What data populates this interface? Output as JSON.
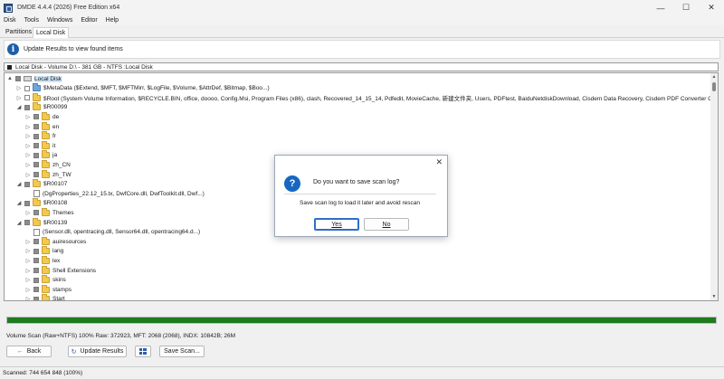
{
  "window": {
    "title": "DMDE 4.4.4 (2026) Free Edition x64",
    "minimize_glyph": "—",
    "maximize_glyph": "☐",
    "close_glyph": "✕"
  },
  "menu": [
    "Disk",
    "Tools",
    "Windows",
    "Editor",
    "Help"
  ],
  "tabs": [
    {
      "label": "Partitions",
      "active": false
    },
    {
      "label": "Local Disk",
      "active": true
    }
  ],
  "info_bar": {
    "icon": "info-icon",
    "icon_glyph": "i",
    "text": "Update Results to view found items"
  },
  "path_bar": {
    "text": "Local Disk - Volume D:\\ - 381 GB - NTFS :Local Disk"
  },
  "tree": [
    {
      "label": "Local Disk",
      "level": 0,
      "toggle": "▲",
      "icon": "drive",
      "checkbox": "partial",
      "selected": true
    },
    {
      "label": "$MetaData ($Extend, $MFT, $MFTMirr, $LogFile, $Volume, $AttrDef, $Bitmap, $Boo...)",
      "level": 1,
      "toggle": "▷",
      "icon": "folder-blue",
      "checkbox": "empty"
    },
    {
      "label": "$Root (System Volume Information, $RECYCLE.BIN, office, doooo, Config.Msi, Program Files (x86), clash, Recovered_14_15_14, Pdfedit, MovieCache, 新建文件夹, Users, PDFtest, BaiduNetdiskDownload, Cisdem Data Recovery, Cisdem PDF Converter O",
      "level": 1,
      "toggle": "▷",
      "icon": "folder",
      "checkbox": "empty"
    },
    {
      "label": "$R00099",
      "level": 1,
      "toggle": "◢",
      "icon": "folder",
      "checkbox": "partial"
    },
    {
      "label": "de",
      "level": 2,
      "toggle": "▷",
      "icon": "folder",
      "checkbox": "partial"
    },
    {
      "label": "en",
      "level": 2,
      "toggle": "▷",
      "icon": "folder",
      "checkbox": "partial"
    },
    {
      "label": "fr",
      "level": 2,
      "toggle": "▷",
      "icon": "folder",
      "checkbox": "partial"
    },
    {
      "label": "it",
      "level": 2,
      "toggle": "▷",
      "icon": "folder",
      "checkbox": "partial"
    },
    {
      "label": "ja",
      "level": 2,
      "toggle": "▷",
      "icon": "folder",
      "checkbox": "partial"
    },
    {
      "label": "zh_CN",
      "level": 2,
      "toggle": "▷",
      "icon": "folder",
      "checkbox": "partial"
    },
    {
      "label": "zh_TW",
      "level": 2,
      "toggle": "▷",
      "icon": "folder",
      "checkbox": "partial"
    },
    {
      "label": "$R00107",
      "level": 1,
      "toggle": "◢",
      "icon": "folder",
      "checkbox": "partial"
    },
    {
      "label": "(DgProperties_22.12_15.tx, DwfCore.dll, DwfToolkit.dll, Dwf...)",
      "level": 2,
      "toggle": "",
      "icon": "file",
      "checkbox": "none"
    },
    {
      "label": "$R00108",
      "level": 1,
      "toggle": "◢",
      "icon": "folder",
      "checkbox": "partial"
    },
    {
      "label": "Themes",
      "level": 2,
      "toggle": "▷",
      "icon": "folder",
      "checkbox": "partial"
    },
    {
      "label": "$R00139",
      "level": 1,
      "toggle": "◢",
      "icon": "folder",
      "checkbox": "partial"
    },
    {
      "label": "(Sensor.dll, opentracing.dll, Sensor64.dll, opentracing64.d...)",
      "level": 2,
      "toggle": "",
      "icon": "file",
      "checkbox": "none"
    },
    {
      "label": "auiresources",
      "level": 2,
      "toggle": "▷",
      "icon": "folder",
      "checkbox": "partial"
    },
    {
      "label": "lang",
      "level": 2,
      "toggle": "▷",
      "icon": "folder",
      "checkbox": "partial"
    },
    {
      "label": "lex",
      "level": 2,
      "toggle": "▷",
      "icon": "folder",
      "checkbox": "partial"
    },
    {
      "label": "Shell Extensions",
      "level": 2,
      "toggle": "▷",
      "icon": "folder",
      "checkbox": "partial"
    },
    {
      "label": "skins",
      "level": 2,
      "toggle": "▷",
      "icon": "folder",
      "checkbox": "partial"
    },
    {
      "label": "stamps",
      "level": 2,
      "toggle": "▷",
      "icon": "folder",
      "checkbox": "partial"
    },
    {
      "label": "Start",
      "level": 2,
      "toggle": "▷",
      "icon": "folder",
      "checkbox": "partial"
    }
  ],
  "progress": {
    "fraction": 1.0,
    "color": "#1e7b1e"
  },
  "scan_status": "Volume Scan (Raw+NTFS) 100% Raw: 372923, MFT: 2068 (2068), INDX: 10842B; 26M",
  "buttons": {
    "back_label": "Back",
    "back_icon": "←",
    "update_label": "Update Results",
    "update_icon": "↻",
    "save_scan_label": "Save Scan..."
  },
  "status_bar": "Scanned: 744 654 848 (100%)",
  "dialog": {
    "icon": "question-icon",
    "icon_glyph": "?",
    "title": "Do you want to save scan log?",
    "message": "Save scan log to load it later and avoid rescan",
    "yes_label": "Yes",
    "no_label": "No",
    "close_glyph": "✕"
  }
}
